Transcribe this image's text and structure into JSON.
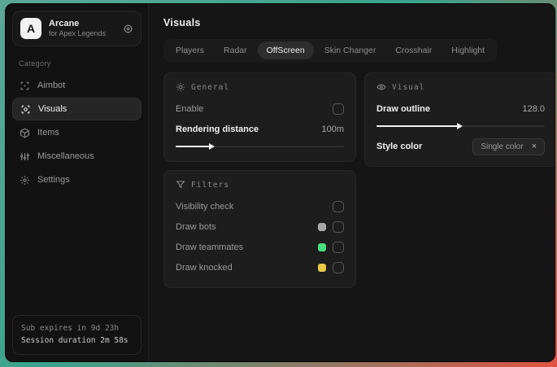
{
  "sidebar": {
    "logo_letter": "A",
    "title": "Arcane",
    "subtitle": "for Apex Legends",
    "category_label": "Category",
    "items": [
      {
        "label": "Aimbot"
      },
      {
        "label": "Visuals"
      },
      {
        "label": "Items"
      },
      {
        "label": "Miscellaneous"
      },
      {
        "label": "Settings"
      }
    ],
    "footer": {
      "sub_expires": "Sub expires in 9d 23h",
      "session_duration": "Session duration 2m 58s"
    }
  },
  "main": {
    "title": "Visuals",
    "tabs": [
      {
        "label": "Players",
        "active": false
      },
      {
        "label": "Radar",
        "active": false
      },
      {
        "label": "OffScreen",
        "active": true
      },
      {
        "label": "Skin Changer",
        "active": false
      },
      {
        "label": "Crosshair",
        "active": false
      },
      {
        "label": "Highlight",
        "active": false
      }
    ],
    "cards": {
      "general": {
        "title": "General",
        "enable_label": "Enable",
        "enable_checked": false,
        "rendering_label": "Rendering distance",
        "rendering_value": "100m",
        "rendering_fill": "22%"
      },
      "visual": {
        "title": "Visual",
        "outline_label": "Draw outline",
        "outline_value": "128.0",
        "outline_fill": "50%",
        "style_label": "Style color",
        "style_value": "Single color",
        "style_clear": "×"
      },
      "filters": {
        "title": "Filters",
        "rows": [
          {
            "label": "Visibility check",
            "swatch": null,
            "checked": false
          },
          {
            "label": "Draw bots",
            "swatch": "#a8a8a8",
            "checked": false
          },
          {
            "label": "Draw teammates",
            "swatch": "#4ade80",
            "checked": false
          },
          {
            "label": "Draw knocked",
            "swatch": "#e7c94c",
            "checked": false
          }
        ]
      }
    }
  },
  "colors": {
    "accent_teal": "#3aa38b",
    "accent_red": "#df5440",
    "swatch_bots": "#a8a8a8",
    "swatch_teammates": "#4ade80",
    "swatch_knocked": "#e7c94c"
  }
}
